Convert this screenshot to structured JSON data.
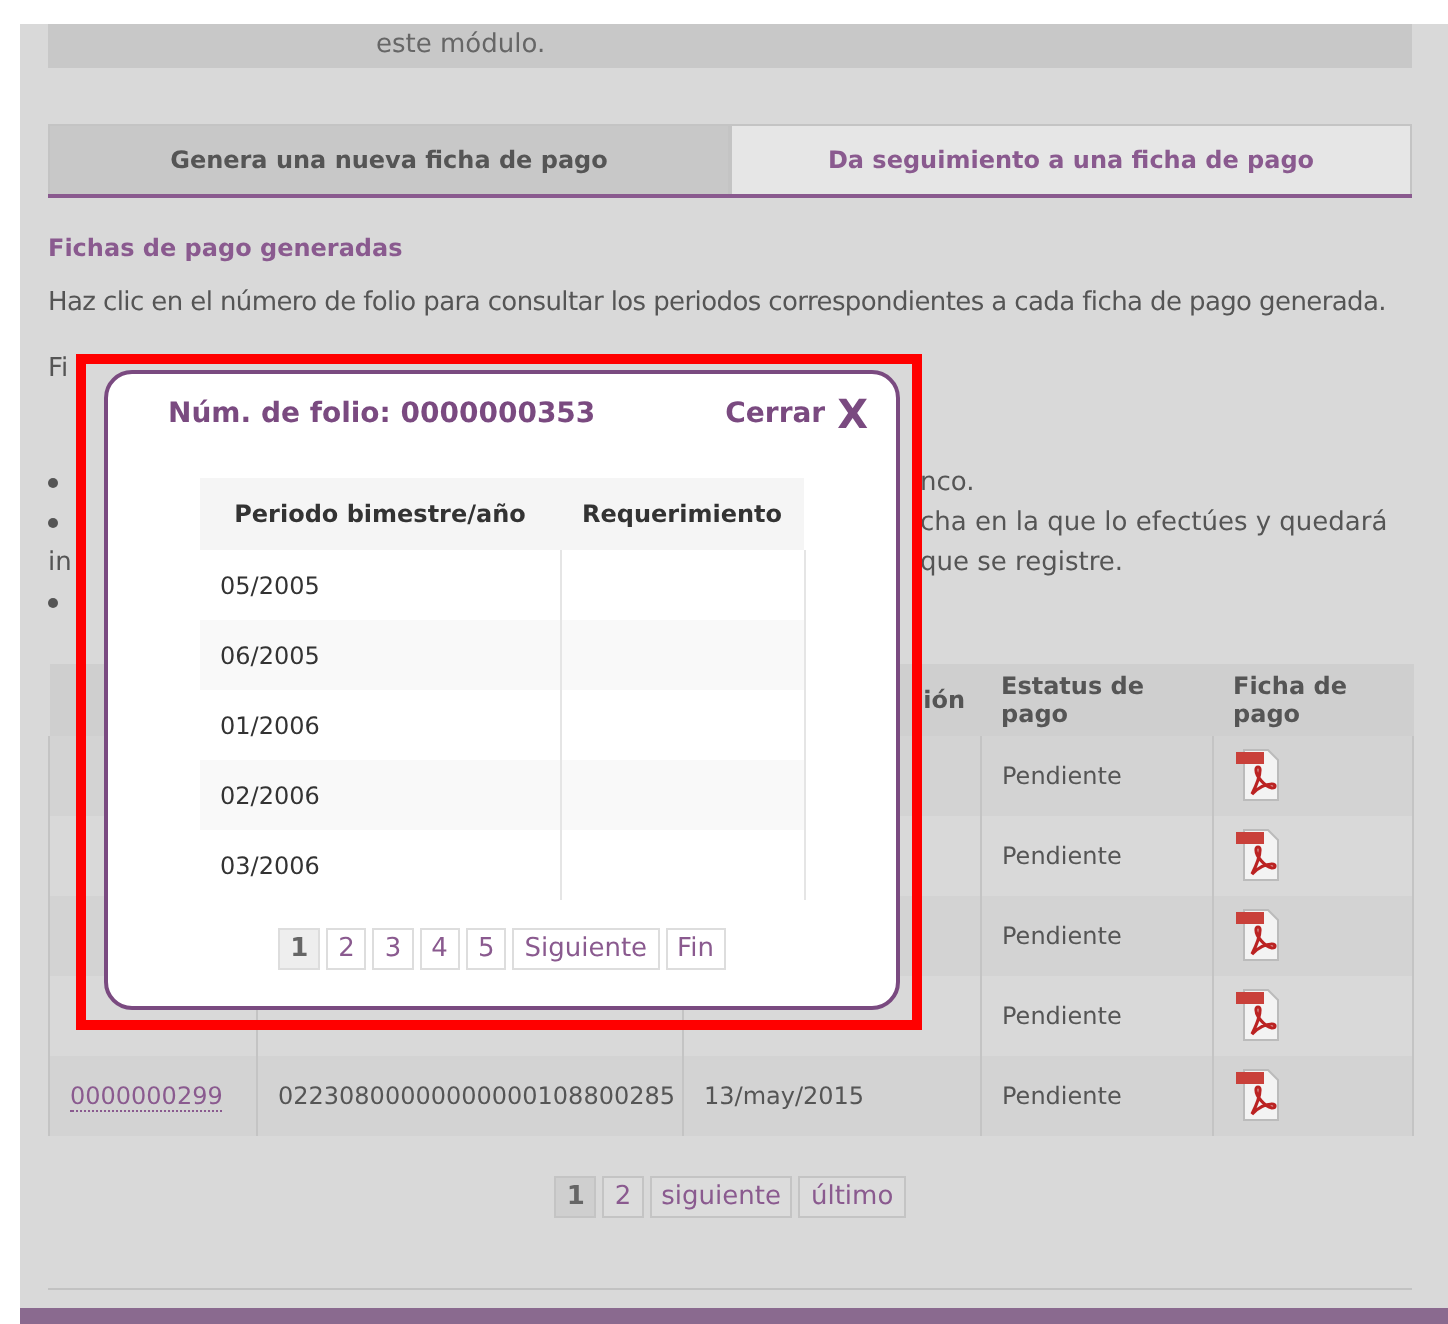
{
  "notice": {
    "text": "este módulo."
  },
  "tabs": [
    {
      "label": "Genera una nueva ficha de pago",
      "selected": false
    },
    {
      "label": "Da seguimiento a una ficha de pago",
      "selected": true
    }
  ],
  "section": {
    "title": "Fichas de pago generadas",
    "description": "Haz clic en el número de folio para consultar los periodos correspondientes a cada ficha de pago generada."
  },
  "filter": {
    "label": "Fi"
  },
  "notes": [
    {
      "right": "nco.",
      "bullet": true
    },
    {
      "right": "cha en la que lo efectúes y quedará",
      "bullet": true
    },
    {
      "left": "in",
      "right": "que se registre.",
      "bullet": false
    },
    {
      "bullet": true
    }
  ],
  "table": {
    "columns": [
      {
        "label": "ión"
      },
      {
        "label": "Estatus de pago"
      },
      {
        "label": "Ficha de pago"
      }
    ],
    "rows": [
      {
        "status": "Pendiente"
      },
      {
        "status": "Pendiente"
      },
      {
        "status": "Pendiente"
      },
      {
        "status": "Pendiente"
      },
      {
        "folio": "0000000299",
        "reference": "02230800000000000108800285",
        "date": "13/may/2015",
        "status": "Pendiente"
      }
    ]
  },
  "pager": [
    {
      "label": "1",
      "selected": true
    },
    {
      "label": "2",
      "selected": false
    },
    {
      "label": "siguiente",
      "selected": false
    },
    {
      "label": "último",
      "selected": false
    }
  ],
  "modal": {
    "title": "Núm. de folio: 0000000353",
    "close_label": "Cerrar",
    "close_icon": "X",
    "columns": [
      "Periodo bimestre/año",
      "Requerimiento"
    ],
    "rows": [
      {
        "period": "05/2005"
      },
      {
        "period": "06/2005"
      },
      {
        "period": "01/2006"
      },
      {
        "period": "02/2006"
      },
      {
        "period": "03/2006"
      }
    ],
    "pager": [
      {
        "label": "1",
        "selected": true
      },
      {
        "label": "2",
        "selected": false
      },
      {
        "label": "3",
        "selected": false
      },
      {
        "label": "4",
        "selected": false
      },
      {
        "label": "5",
        "selected": false
      },
      {
        "label": "Siguiente",
        "selected": false
      },
      {
        "label": "Fin",
        "selected": false
      }
    ]
  }
}
